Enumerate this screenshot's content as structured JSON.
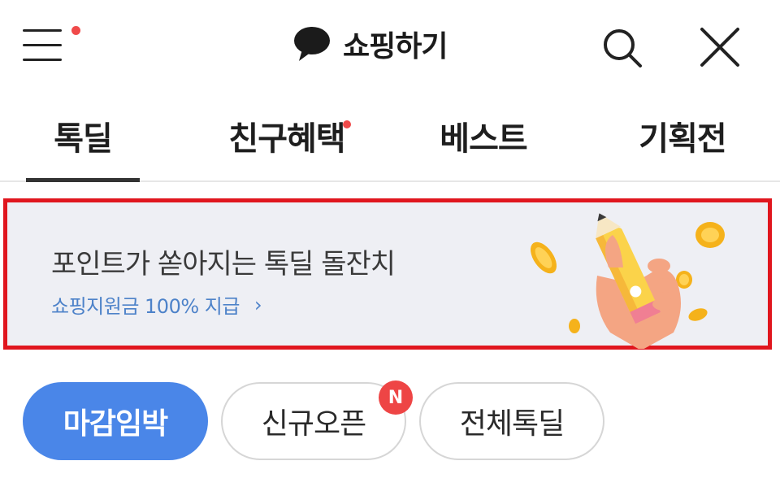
{
  "header": {
    "title": "쇼핑하기",
    "menu_icon": "hamburger-menu-icon",
    "chat_icon": "speech-bubble-icon",
    "search_icon": "search-icon",
    "close_icon": "close-icon",
    "notification_dot_color": "#f04a4a"
  },
  "tabs": [
    {
      "label": "톡딜",
      "active": true
    },
    {
      "label": "친구혜택",
      "has_dot": true
    },
    {
      "label": "베스트"
    },
    {
      "label": "기획전"
    }
  ],
  "banner": {
    "title": "포인트가 쏟아지는 톡딜 돌잔치",
    "link_text": "쇼핑지원금 100% 지급",
    "link_chevron": "›",
    "illustration": "hand-holding-pencil-with-coins",
    "border_color": "#e0161e"
  },
  "filters": [
    {
      "label": "마감임박",
      "active": true
    },
    {
      "label": "신규오픈",
      "badge": "N"
    },
    {
      "label": "전체톡딜"
    }
  ],
  "colors": {
    "accent": "#4a86e8",
    "badge": "#ee4545",
    "link": "#4d82c9"
  }
}
